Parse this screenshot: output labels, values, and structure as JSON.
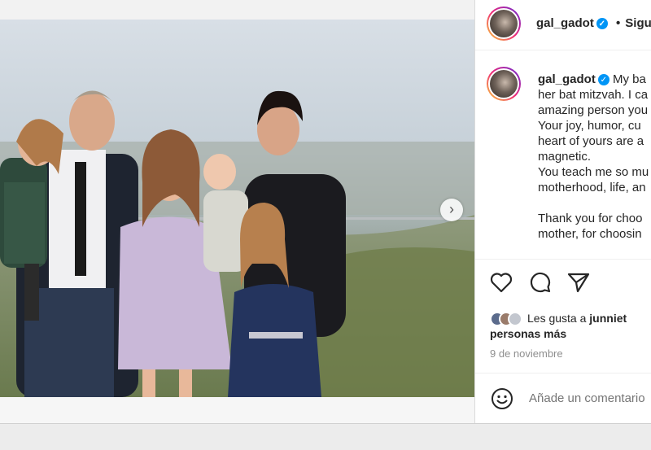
{
  "post": {
    "username": "gal_gadot",
    "follow_label": "Sigu",
    "caption_lines": [
      "My ba",
      "her bat mitzvah. I ca",
      "amazing person you",
      "Your joy, humor, cu",
      "heart of yours are a",
      "magnetic.",
      "You teach me so mu",
      "motherhood, life, an",
      "",
      "Thank you for choo",
      "mother, for choosin"
    ],
    "likes_prefix": "Les gusta a",
    "likes_user": "junniet",
    "likes_suffix": "personas más",
    "date": "9 de noviembre",
    "comment_placeholder": "Añade un comentario",
    "next_arrow": "›"
  },
  "icons": {
    "like": "heart-icon",
    "comment": "comment-icon",
    "share": "send-icon",
    "emoji": "emoji-icon",
    "verified": "verified-badge-icon"
  },
  "colors": {
    "verified": "#0095f6",
    "text": "#262626",
    "muted": "#8e8e8e"
  }
}
